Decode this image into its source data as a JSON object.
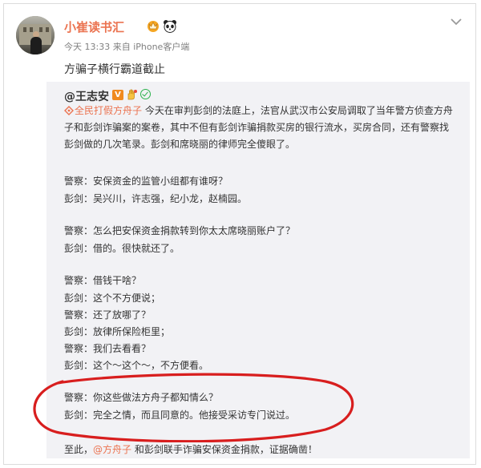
{
  "post": {
    "username": "小崔读书汇",
    "meta": "今天 13:33 来自 iPhone客户端",
    "text": "方骗子横行霸道截止"
  },
  "quoted": {
    "username": "@王志安",
    "verified_badge": "V",
    "hashtag_text": "全民打假方舟子",
    "paragraph_rest": " 今天在审判彭剑的法庭上，法官从武汉市公安局调取了当年警方侦查方舟子和彭剑诈骗案的案卷，其中不但有彭剑诈骗捐款买房的银行流水，买房合同，还有警察找彭剑做的几次笔录。彭剑和席晓丽的律师完全傻眼了。",
    "dialogue": [
      "警察：安保资金的监管小组都有谁呀？",
      "彭剑：吴兴川，许志强，纪小龙，赵楠园。",
      "警察：怎么把安保资金捐款转到你太太席晓丽账户了？",
      "彭剑：借的。很快就还了。",
      "警察：借钱干啥？",
      "彭剑：这个不方便说；",
      "警察：还了放哪了？",
      "彭剑：放律所保险柜里；",
      "警察：我们去看看？",
      "彭剑：这个～这个～，不方便看。",
      "警察：你这些做法方舟子都知情么？",
      "彭剑：完全之情，而且同意的。他接受采访专门说过。"
    ],
    "final_prefix": "至此，",
    "final_mention": "@方舟子",
    "final_rest": " 和彭剑联手诈骗安保资金捐款，证据确凿！"
  },
  "colors": {
    "accent": "#eb7350",
    "highlight_circle": "#d81e1e",
    "quote_bg": "#f2f2f5"
  },
  "icons": [
    "avatar",
    "crown-badge-icon",
    "panda-icon",
    "chevron-down-icon",
    "verified-v-icon",
    "hand-badge-icon",
    "check-badge-icon",
    "hashtag-icon"
  ]
}
